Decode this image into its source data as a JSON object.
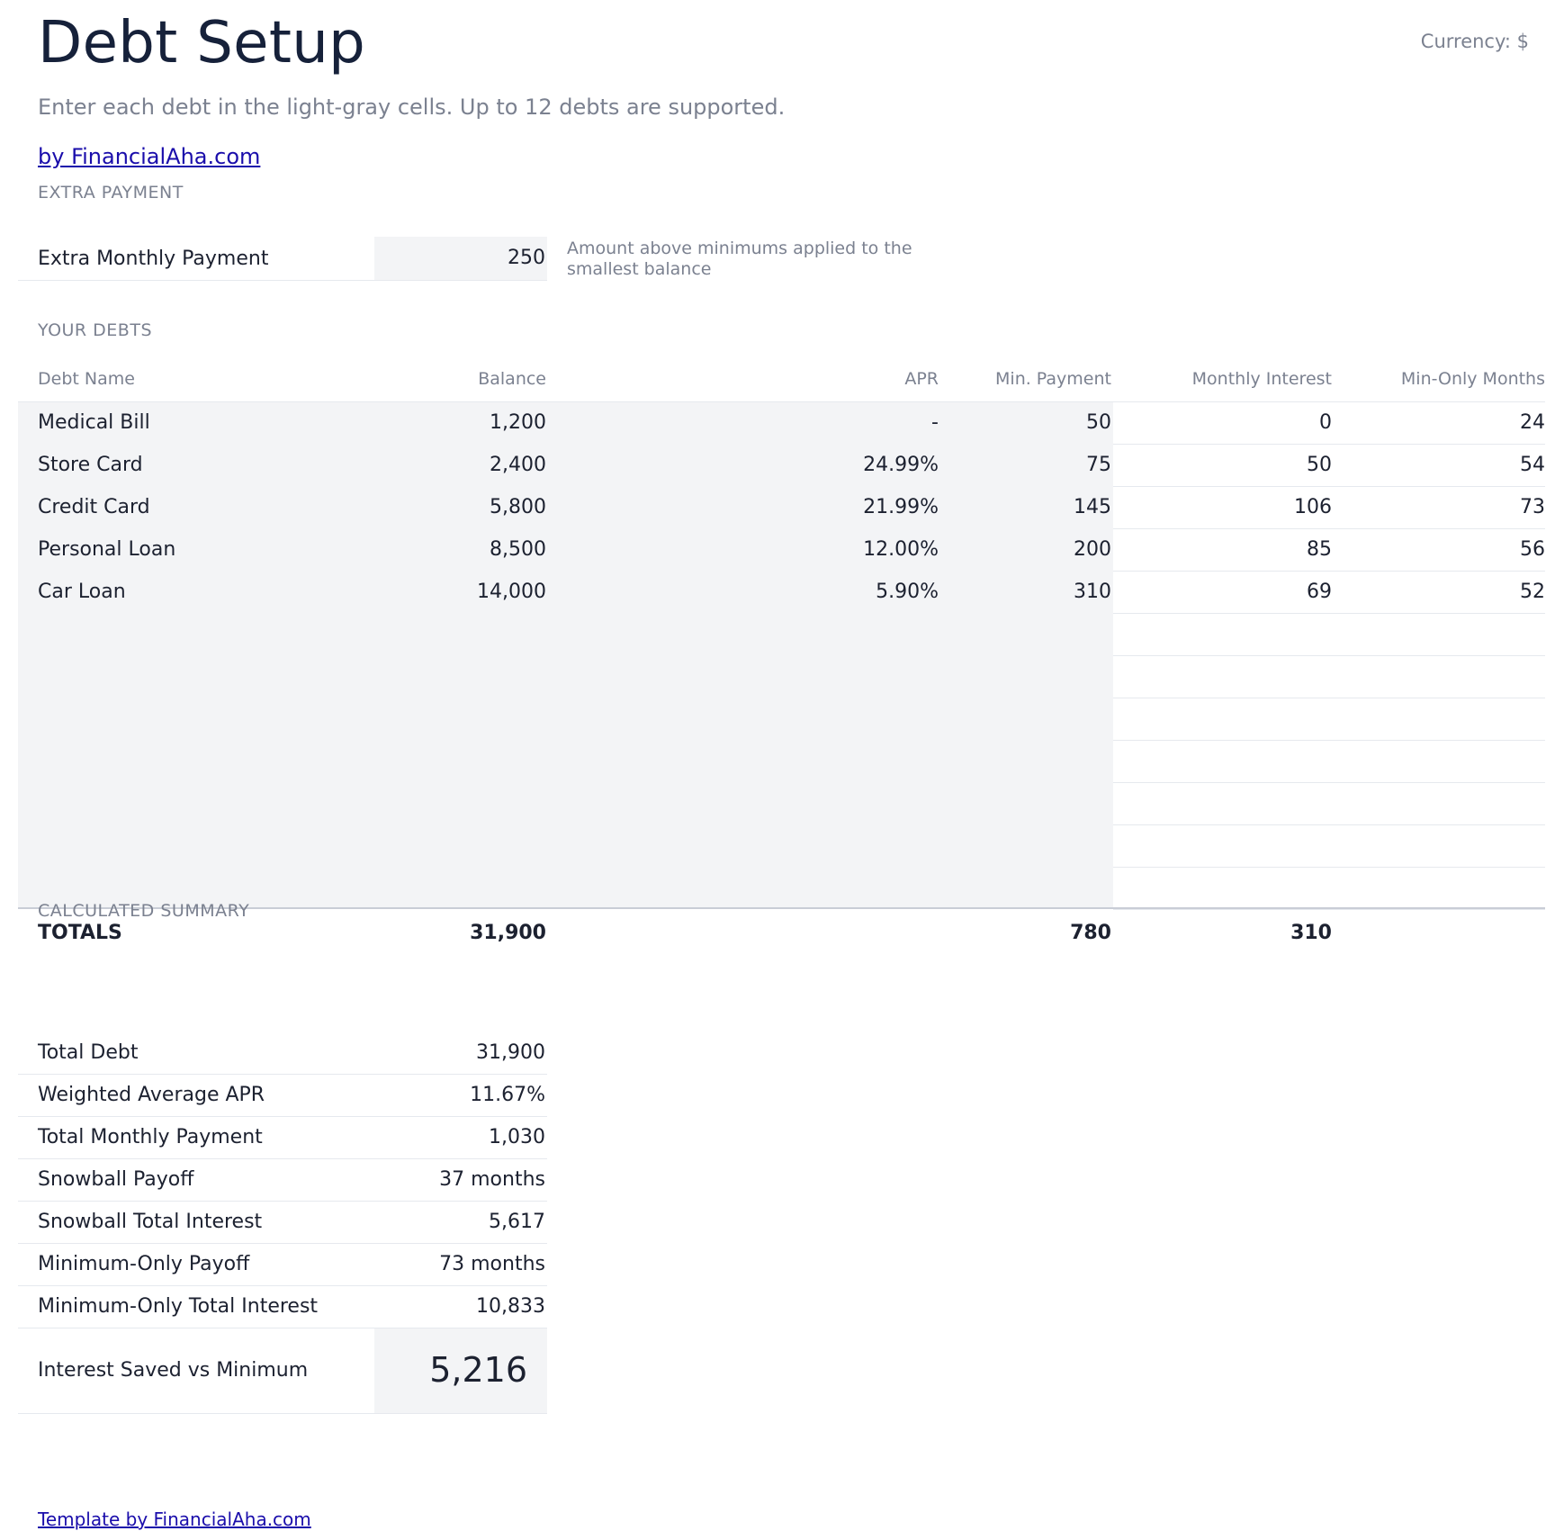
{
  "header": {
    "title": "Debt Setup",
    "currency": "Currency: $",
    "subtitle": "Enter each debt in the light-gray cells. Up to 12 debts are supported.",
    "brand_link": "by FinancialAha.com"
  },
  "extra_payment": {
    "section_label": "EXTRA PAYMENT",
    "label": "Extra Monthly Payment",
    "value": "250",
    "note": "Amount above minimums applied to the smallest balance"
  },
  "debts": {
    "section_label": "YOUR DEBTS",
    "columns": {
      "name": "Debt Name",
      "balance": "Balance",
      "apr": "APR",
      "min_payment": "Min. Payment",
      "monthly_interest": "Monthly Interest",
      "min_only_months": "Min-Only Months"
    },
    "rows": [
      {
        "name": "Medical Bill",
        "balance": "1,200",
        "apr": "-",
        "min_payment": "50",
        "monthly_interest": "0",
        "min_only_months": "24"
      },
      {
        "name": "Store Card",
        "balance": "2,400",
        "apr": "24.99%",
        "min_payment": "75",
        "monthly_interest": "50",
        "min_only_months": "54"
      },
      {
        "name": "Credit Card",
        "balance": "5,800",
        "apr": "21.99%",
        "min_payment": "145",
        "monthly_interest": "106",
        "min_only_months": "73"
      },
      {
        "name": "Personal Loan",
        "balance": "8,500",
        "apr": "12.00%",
        "min_payment": "200",
        "monthly_interest": "85",
        "min_only_months": "56"
      },
      {
        "name": "Car Loan",
        "balance": "14,000",
        "apr": "5.90%",
        "min_payment": "310",
        "monthly_interest": "69",
        "min_only_months": "52"
      },
      {
        "name": "",
        "balance": "",
        "apr": "",
        "min_payment": "",
        "monthly_interest": "",
        "min_only_months": ""
      },
      {
        "name": "",
        "balance": "",
        "apr": "",
        "min_payment": "",
        "monthly_interest": "",
        "min_only_months": ""
      },
      {
        "name": "",
        "balance": "",
        "apr": "",
        "min_payment": "",
        "monthly_interest": "",
        "min_only_months": ""
      },
      {
        "name": "",
        "balance": "",
        "apr": "",
        "min_payment": "",
        "monthly_interest": "",
        "min_only_months": ""
      },
      {
        "name": "",
        "balance": "",
        "apr": "",
        "min_payment": "",
        "monthly_interest": "",
        "min_only_months": ""
      },
      {
        "name": "",
        "balance": "",
        "apr": "",
        "min_payment": "",
        "monthly_interest": "",
        "min_only_months": ""
      },
      {
        "name": "",
        "balance": "",
        "apr": "",
        "min_payment": "",
        "monthly_interest": "",
        "min_only_months": ""
      }
    ],
    "totals": {
      "label": "TOTALS",
      "balance": "31,900",
      "min_payment": "780",
      "monthly_interest": "310"
    }
  },
  "summary": {
    "section_label": "CALCULATED SUMMARY",
    "items": [
      {
        "label": "Total Debt",
        "value": "31,900"
      },
      {
        "label": "Weighted Average APR",
        "value": "11.67%"
      },
      {
        "label": "Total Monthly Payment",
        "value": "1,030"
      },
      {
        "label": "Snowball Payoff",
        "value": "37 months"
      },
      {
        "label": "Snowball Total Interest",
        "value": "5,617"
      },
      {
        "label": "Minimum-Only Payoff",
        "value": "73 months"
      },
      {
        "label": "Minimum-Only Total Interest",
        "value": "10,833"
      }
    ],
    "saved": {
      "label": "Interest Saved vs Minimum",
      "value": "5,216"
    }
  },
  "footer": {
    "link": "Template by FinancialAha.com"
  },
  "colors": {
    "input_fill": "#f3f4f6",
    "title": "#16213a",
    "muted": "#7b8190",
    "link": "#1a0dab"
  }
}
